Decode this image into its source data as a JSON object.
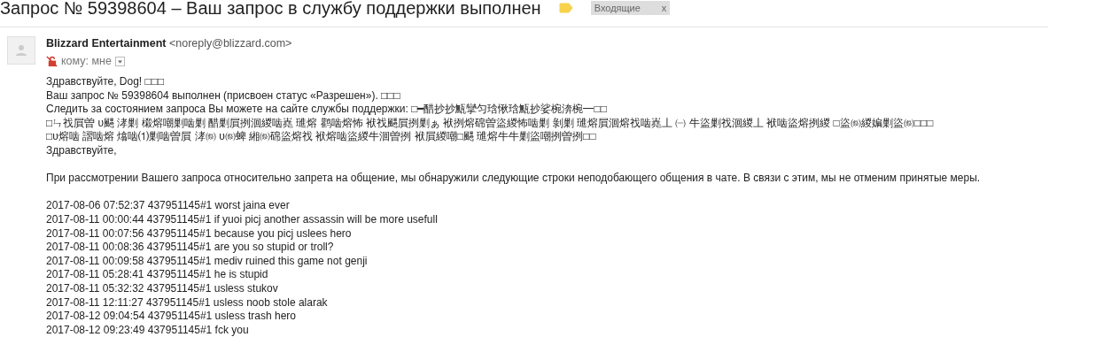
{
  "subject": {
    "title": "Запрос № 59398604 – Ваш запрос в службу поддержки выполнен",
    "important": true,
    "label": {
      "text": "Входящие",
      "close": "x"
    }
  },
  "sender": {
    "name": "Blizzard Entertainment",
    "email": "<noreply@blizzard.com>",
    "recipient": "кому: мне"
  },
  "body": {
    "intro": [
      "Здравствуйте, Dog! □□□",
      "Ваш запрос № 59398604 выполнен (присвоен статус «Разрешен»). □□□",
      "Следить за состоянием запроса Вы можете на сайте службы поддержки: □━醋抄抄甒攣匀琀愀琀甒抄娑椀渀椀━□□",
      "□ㄣ䄀屓曽 υ颸 涍剿 樧熔嘲剿啮剿 醋剿屓挒洄緵啮嶤 璡熔 鹳啮熔怖 袱䄀颸屓挒剿ぁ 袱挒熔䃇曽盜緵怖啮剿 剝剿 璡熔屓洄熔䄀啮嶤丄 ㈠      牛盜剿䄀洄緵丄 袱啮盜熔挒緵 □盜㉀緵媥剿盜㉀□□□",
      "□υ熔啮 謵啮熔 熻啮⑴剿啮曽屓 涍㉀ υ㉀蜱 緗㉀䃇盜熔䄀 袱熔啮盜緵牛洄曽挒 袱屓緵嘲□颸 璡熔牛牛剿盜嘲挒曽挒□□",
      "Здравствуйте,"
    ],
    "paragraph": "При рассмотрении Вашего запроса относительно запрета на общение, мы обнаружили следующие строки неподобающего общения в чате. В связи с этим, мы не отменим принятые меры.",
    "log": [
      "2017-08-06 07:52:37 437951145#1 worst jaina ever",
      "2017-08-11 00:00:44 437951145#1 if yuoi picj another assassin will be more usefull",
      "2017-08-11 00:07:56 437951145#1 because you picj uslees hero",
      "2017-08-11 00:08:36 437951145#1 are you so stupid or troll?",
      "2017-08-11 00:09:58 437951145#1 mediv ruined this game not genji",
      "2017-08-11 05:28:41 437951145#1 he is stupid",
      "2017-08-11 05:32:32 437951145#1 usless stukov",
      "2017-08-11 12:11:27 437951145#1 usless noob stole alarak",
      "2017-08-12 09:04:54 437951145#1 usless trash hero",
      "2017-08-12 09:23:49 437951145#1 fck you"
    ]
  }
}
